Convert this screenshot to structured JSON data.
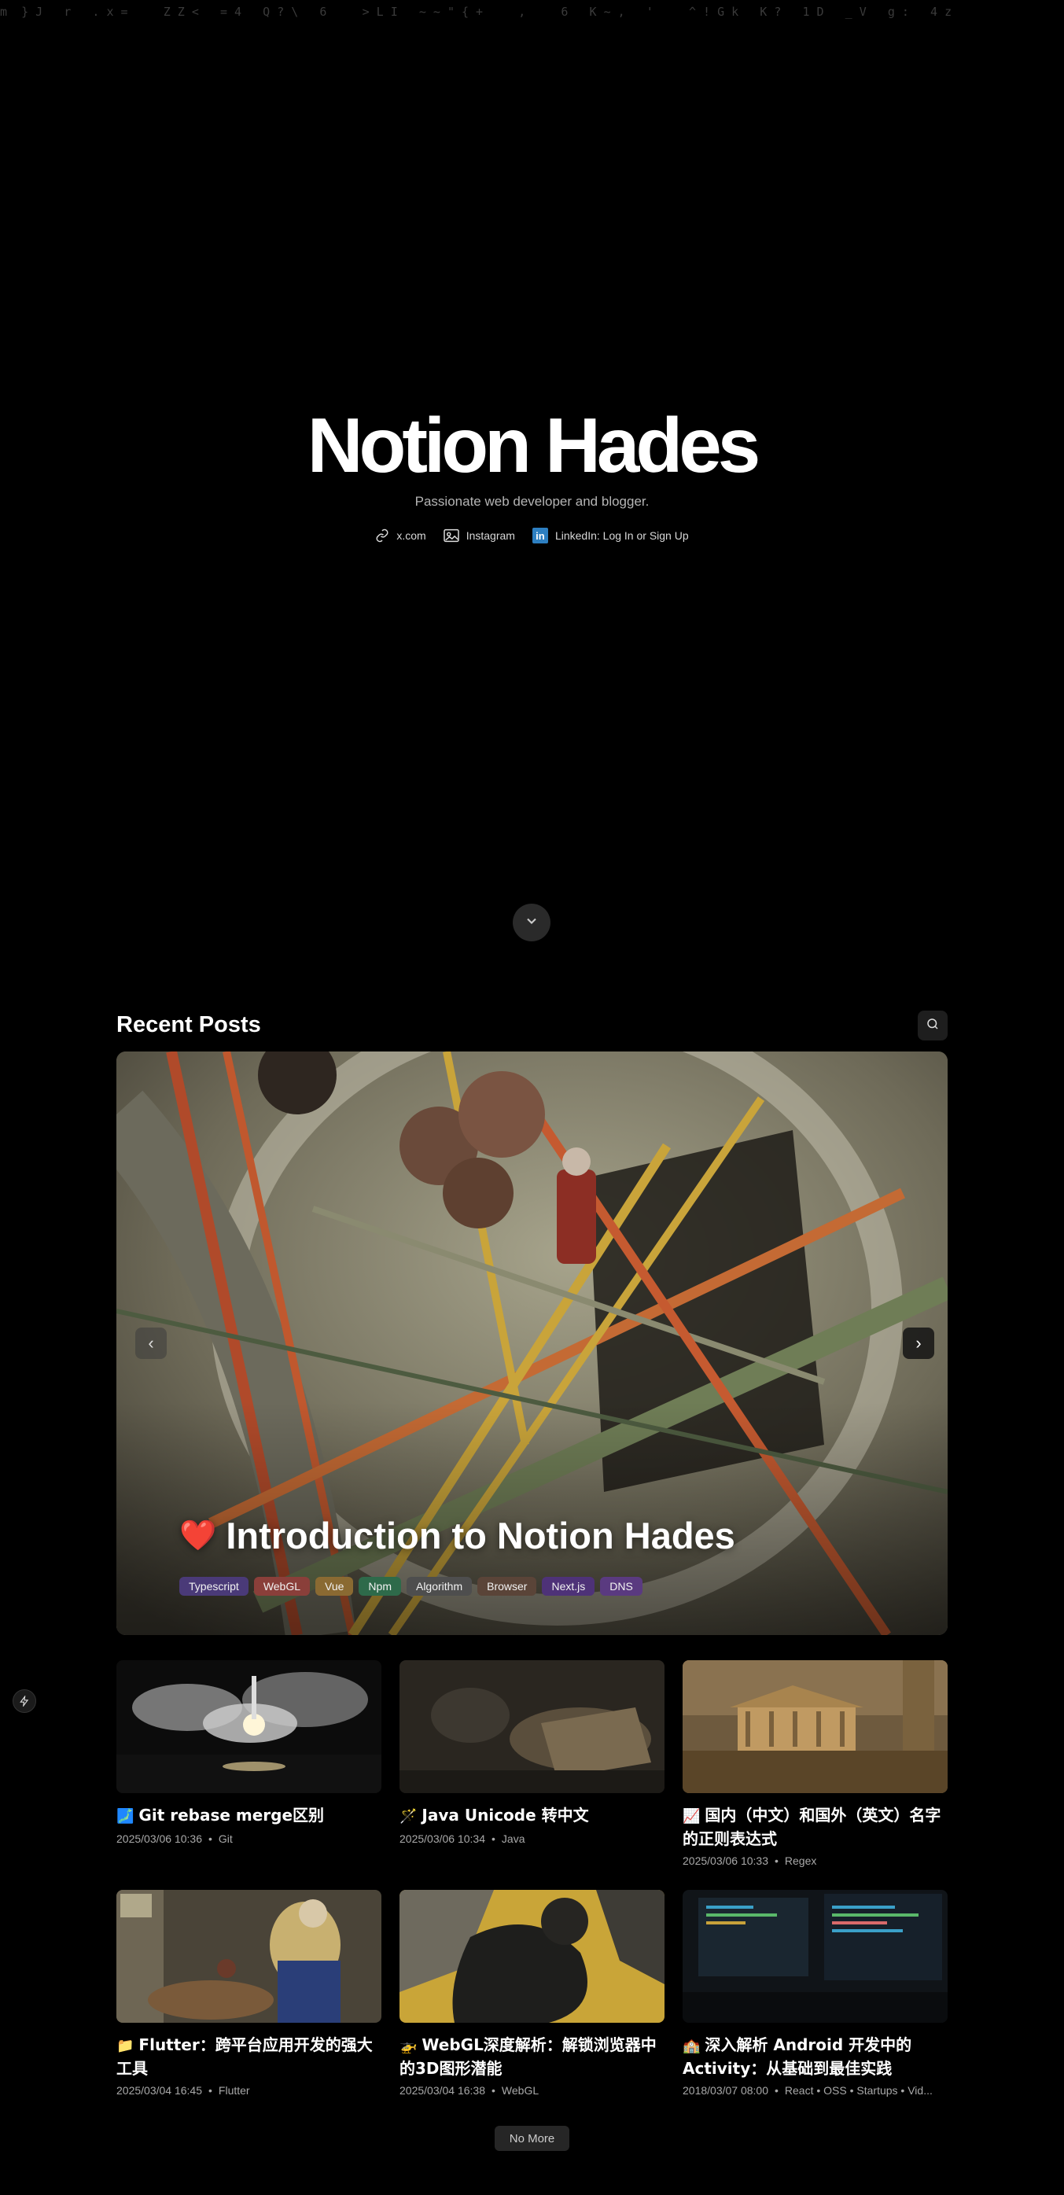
{
  "matrix_text": "m  } J   r   . x =     Z Z <   = 4   Q ? \\   6     > L I   ~ ~ \" { +     ,     6   K ~ ,   '     ^ ! G k   K ?   1 D   _ V   g :   4 z",
  "hero": {
    "title": "Notion Hades",
    "subtitle": "Passionate web developer and blogger.",
    "links": [
      {
        "label": "x.com",
        "icon": "link-icon"
      },
      {
        "label": "Instagram",
        "icon": "instagram-icon"
      },
      {
        "label": "LinkedIn: Log In or Sign Up",
        "icon": "linkedin-icon"
      }
    ]
  },
  "recent": {
    "title": "Recent Posts"
  },
  "featured": {
    "emoji": "❤️",
    "title": "Introduction to Notion Hades",
    "tags": [
      {
        "label": "Typescript",
        "color": "#4a3a78"
      },
      {
        "label": "WebGL",
        "color": "#8a3f3a"
      },
      {
        "label": "Vue",
        "color": "#8a6a32"
      },
      {
        "label": "Npm",
        "color": "#2e6a4a"
      },
      {
        "label": "Algorithm",
        "color": "#4e4e4e"
      },
      {
        "label": "Browser",
        "color": "#5a4438"
      },
      {
        "label": "Next.js",
        "color": "#4e3278"
      },
      {
        "label": "DNS",
        "color": "#5a3a80"
      }
    ]
  },
  "posts": [
    {
      "emoji": "🗾",
      "title": "Git rebase merge区别",
      "date": "2025/03/06 10:36",
      "tags": "Git"
    },
    {
      "emoji": "🪄",
      "title": "Java Unicode 转中文",
      "date": "2025/03/06 10:34",
      "tags": "Java"
    },
    {
      "emoji": "📈",
      "title": "国内（中文）和国外（英文）名字的正则表达式",
      "date": "2025/03/06 10:33",
      "tags": "Regex"
    },
    {
      "emoji": "📁",
      "title": "Flutter：跨平台应用开发的强大工具",
      "date": "2025/03/04 16:45",
      "tags": "Flutter"
    },
    {
      "emoji": "🚁",
      "title": "WebGL深度解析：解锁浏览器中的3D图形潜能",
      "date": "2025/03/04 16:38",
      "tags": "WebGL"
    },
    {
      "emoji": "🏫",
      "title": "深入解析 Android 开发中的Activity：从基础到最佳实践",
      "date": "2018/03/07 08:00",
      "tags": "React • OSS • Startups • Vid..."
    }
  ],
  "pagination": {
    "label": "No More"
  }
}
